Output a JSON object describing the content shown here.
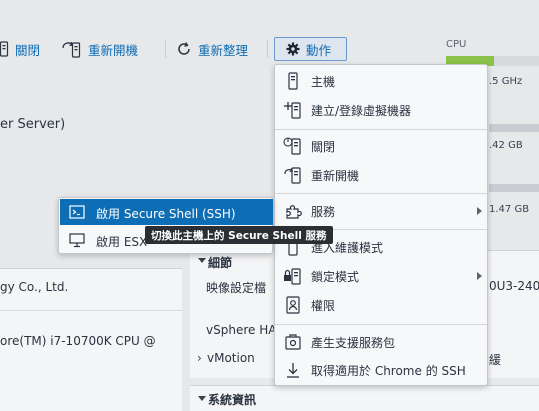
{
  "toolbar": {
    "shutdown_label": "關閉",
    "reboot_label": "重新開機",
    "refresh_label": "重新整理",
    "actions_label": "動作"
  },
  "summary": {
    "server_fragment": "er Server)",
    "cpu_label": "CPU",
    "cpu_value_fragment": ".5 GHz",
    "memory_value_fragment": ".42 GB",
    "storage_value_fragment": "1.47 GB"
  },
  "panels": {
    "vendor_fragment": "gy Co., Ltd.",
    "cpu_model_fragment": "ore(TM) i7-10700K CPU @",
    "details_header": "細節",
    "image_profile_label": "映像設定檔",
    "image_profile_value_fragment": "0U3-240",
    "vsphere_ha_label": "vSphere HA",
    "vmotion_label": "vMotion",
    "vmotion_value_fragment": "緩",
    "sysinfo_header": "系統資訊"
  },
  "actions_menu": {
    "items": [
      {
        "label": "主機",
        "icon": "host-icon"
      },
      {
        "label": "建立/登錄虛擬機器",
        "icon": "add-vm-icon"
      },
      {
        "label": "關閉",
        "icon": "power-off-icon"
      },
      {
        "label": "重新開機",
        "icon": "reboot-icon"
      },
      {
        "label": "服務",
        "icon": "services-icon"
      },
      {
        "label": "進入維護模式",
        "icon": "maintenance-icon"
      },
      {
        "label": "鎖定模式",
        "icon": "lock-icon"
      },
      {
        "label": "權限",
        "icon": "permissions-icon"
      },
      {
        "label": "產生支援服務包",
        "icon": "support-bundle-icon"
      },
      {
        "label": "取得適用於 Chrome 的 SSH",
        "icon": "download-icon"
      }
    ]
  },
  "services_submenu": {
    "items": [
      {
        "label": "啟用 Secure Shell (SSH)",
        "icon": "terminal-icon"
      },
      {
        "label": "啟用 ESX",
        "icon": "monitor-icon"
      }
    ]
  },
  "tooltip": {
    "text": "切換此主機上的 Secure Shell 服務"
  },
  "colors": {
    "accent": "#0f6bb3",
    "highlight": "#0d6eb5",
    "cpu_bar": "#8bc34a"
  }
}
